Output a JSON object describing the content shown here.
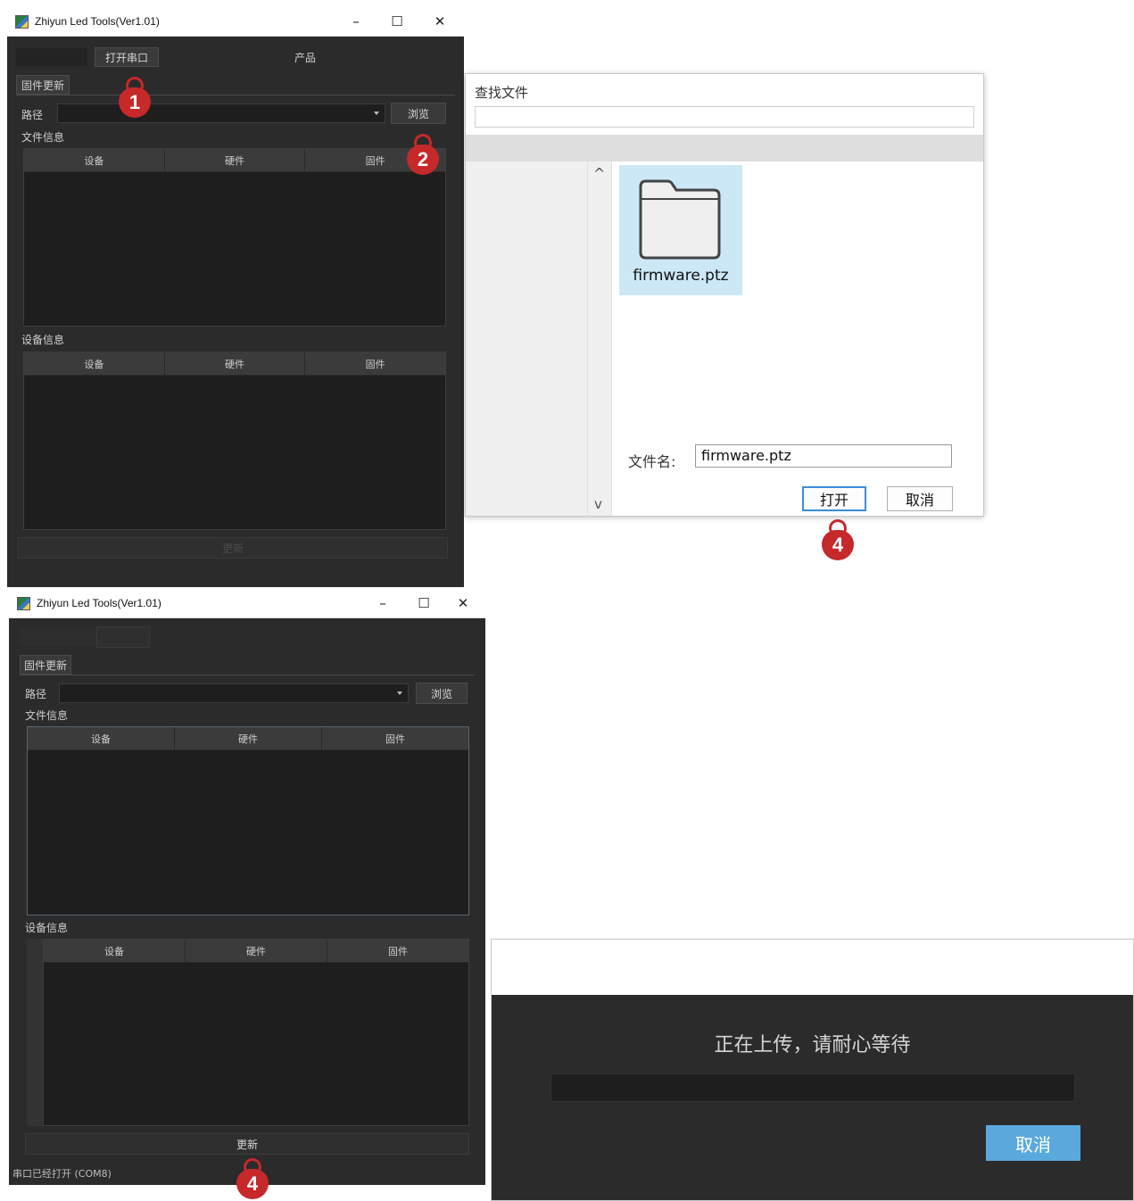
{
  "window1": {
    "title": "Zhiyun Led Tools(Ver1.01)",
    "minimize": "–",
    "maximize": "☐",
    "close": "✕",
    "open_port_button": "打开串口",
    "product_label": "产品",
    "tab_firmware_update": "固件更新",
    "path_label": "路径",
    "browse_button": "浏览",
    "file_info_label": "文件信息",
    "device_info_label": "设备信息",
    "columns": [
      "设备",
      "硬件",
      "固件"
    ],
    "update_button": "更新"
  },
  "file_dialog": {
    "title": "查找文件",
    "file_item_name": "firmware.ptz",
    "filename_label": "文件名:",
    "filename_value": "firmware.ptz",
    "open_button": "打开",
    "cancel_button": "取消",
    "scroll_up": "^",
    "scroll_down": "v"
  },
  "window2": {
    "title": "Zhiyun Led Tools(Ver1.01)",
    "minimize": "–",
    "maximize": "☐",
    "close": "✕",
    "tab_firmware_update": "固件更新",
    "path_label": "路径",
    "browse_button": "浏览",
    "file_info_label": "文件信息",
    "device_info_label": "设备信息",
    "columns": [
      "设备",
      "硬件",
      "固件"
    ],
    "update_button": "更新",
    "status_text": "串口已经打开 (COM8)"
  },
  "upload_dialog": {
    "message": "正在上传，请耐心等待",
    "cancel_button": "取消",
    "progress": 0
  },
  "markers": {
    "m1": "1",
    "m2": "2",
    "m4a": "4",
    "m4b": "4"
  },
  "colors": {
    "marker_red": "#c7282a",
    "selection_blue": "#cce8f6",
    "cancel_blue": "#5aa9dd"
  }
}
